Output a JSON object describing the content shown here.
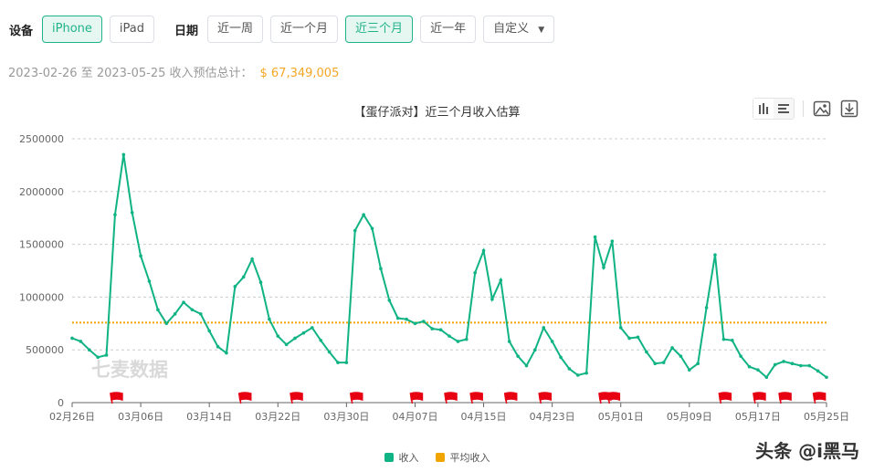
{
  "filters": {
    "device_label": "设备",
    "devices": [
      {
        "label": "iPhone",
        "active": true
      },
      {
        "label": "iPad",
        "active": false
      }
    ],
    "date_label": "日期",
    "ranges": [
      {
        "label": "近一周",
        "active": false
      },
      {
        "label": "近一个月",
        "active": false
      },
      {
        "label": "近三个月",
        "active": true
      },
      {
        "label": "近一年",
        "active": false
      }
    ],
    "custom_label": "自定义"
  },
  "summary": {
    "text": "2023-02-26 至 2023-05-25 收入预估总计：",
    "total": "$ 67,349,005"
  },
  "toolbar": {
    "icons": [
      "bar-chart-icon",
      "list-icon",
      "image-icon",
      "download-icon"
    ]
  },
  "watermark": "七麦数据",
  "source_watermark": "头条 @i黑马",
  "colors": {
    "accent": "#1fb387",
    "line": "#10b383",
    "average": "#f0a500",
    "flag": "#e60012"
  },
  "chart_data": {
    "type": "line",
    "title": "【蛋仔派对】近三个月收入估算",
    "xlabel": "",
    "ylabel": "",
    "ylim": [
      0,
      2500000
    ],
    "yticks": [
      "0",
      "500000",
      "1000000",
      "1500000",
      "2000000",
      "2500000"
    ],
    "xtick_labels": [
      "02月26日",
      "03月06日",
      "03月14日",
      "03月22日",
      "03月30日",
      "04月07日",
      "04月15日",
      "04月23日",
      "05月01日",
      "05月09日",
      "05月17日",
      "05月25日"
    ],
    "xtick_every_days": 8,
    "start_date": "2023-02-26",
    "grid": true,
    "legend_position": "bottom",
    "series": [
      {
        "name": "收入",
        "color": "#10b383",
        "values": [
          610000,
          580000,
          500000,
          430000,
          450000,
          1780000,
          2350000,
          1800000,
          1390000,
          1150000,
          880000,
          750000,
          840000,
          950000,
          880000,
          840000,
          680000,
          530000,
          470000,
          1100000,
          1190000,
          1360000,
          1140000,
          790000,
          630000,
          550000,
          610000,
          660000,
          710000,
          590000,
          480000,
          380000,
          380000,
          1630000,
          1780000,
          1650000,
          1270000,
          970000,
          800000,
          790000,
          750000,
          770000,
          700000,
          690000,
          630000,
          580000,
          600000,
          1230000,
          1440000,
          980000,
          1160000,
          580000,
          440000,
          350000,
          500000,
          710000,
          580000,
          430000,
          320000,
          260000,
          280000,
          1570000,
          1280000,
          1530000,
          710000,
          610000,
          620000,
          480000,
          370000,
          380000,
          520000,
          440000,
          310000,
          370000,
          900000,
          1400000,
          600000,
          590000,
          440000,
          340000,
          310000,
          240000,
          360000,
          390000,
          370000,
          350000,
          350000,
          300000,
          240000
        ]
      },
      {
        "name": "平均收入",
        "color": "#f0a500",
        "value": 758000
      }
    ],
    "event_flag_day_indices": [
      5,
      20,
      26,
      33,
      40,
      44,
      47,
      51,
      55,
      62,
      63,
      76,
      80,
      83,
      87
    ]
  }
}
